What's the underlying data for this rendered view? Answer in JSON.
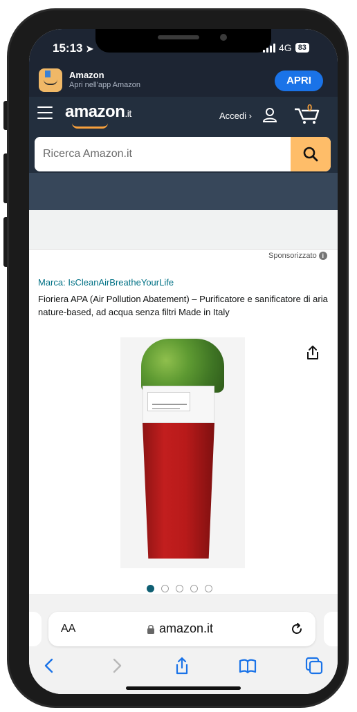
{
  "status": {
    "time": "15:13",
    "network": "4G",
    "battery": "83"
  },
  "app_banner": {
    "name": "Amazon",
    "subtitle": "Apri nell'app Amazon",
    "open_label": "APRI"
  },
  "header": {
    "logo": "amazon",
    "logo_tld": ".it",
    "signin_label": "Accedi ›",
    "cart_count": "0"
  },
  "search": {
    "placeholder": "Ricerca Amazon.it"
  },
  "product": {
    "sponsored_label": "Sponsorizzato",
    "brand": "Marca: IsCleanAirBreatheYourLife",
    "title": "Fioriera APA (Air Pollution Abatement) – Purificatore e sanificatore di aria nature-based, ad acqua senza filtri Made in Italy",
    "image_count": 5,
    "active_image": 1
  },
  "browser": {
    "text_size_label": "AA",
    "url": "amazon.it"
  },
  "colors": {
    "nav": "#232f3e",
    "accent": "#febd69",
    "link": "#007185",
    "open_button": "#1a73e8"
  },
  "icons": [
    "hamburger-icon",
    "user-icon",
    "cart-icon",
    "search-icon",
    "share-icon",
    "lock-icon",
    "reload-icon",
    "back-icon",
    "forward-icon",
    "share-sheet-icon",
    "bookmarks-icon",
    "tabs-icon"
  ]
}
